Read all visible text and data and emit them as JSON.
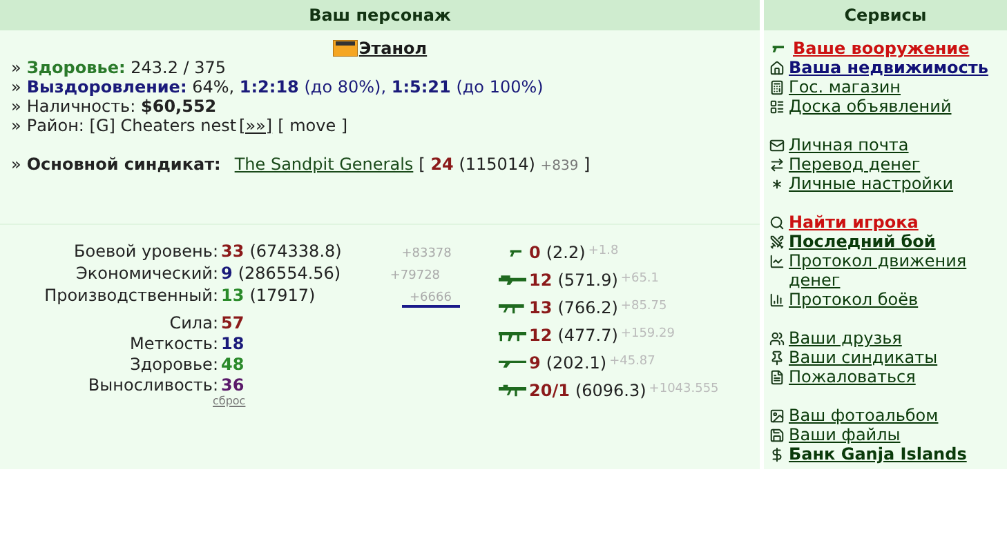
{
  "character": {
    "title": "Ваш персонаж",
    "name": "Этанол",
    "health": {
      "bullet": "»",
      "label": "Здоровье:",
      "value": "243.2 / 375"
    },
    "recovery": {
      "bullet": "»",
      "label": "Выздоровление:",
      "percent": "64%,",
      "t1": "1:2:18",
      "t1_note": "(до 80%),",
      "t2": "1:5:21",
      "t2_note": "(до 100%)"
    },
    "cash": {
      "bullet": "»",
      "label": "Наличность:",
      "value": "$60,552"
    },
    "district": {
      "bullet": "»",
      "label": "Район:",
      "value": "[G] Cheaters nest",
      "link": "[»»]",
      "move": "[ move ]"
    },
    "syndicate": {
      "bullet": "»",
      "label": "Основной синдикат:",
      "name": "The Sandpit Generals",
      "open": "[",
      "level": "24",
      "points": "(115014)",
      "delta": "+839",
      "close": "]"
    }
  },
  "levels": [
    {
      "label": "Боевой уровень:",
      "value": "33",
      "detail": "(674338.8)",
      "delta": "+83378",
      "color": "#8b1a1a",
      "underlined": false
    },
    {
      "label": "Экономический:",
      "value": "9",
      "detail": "(286554.56)",
      "delta": "+79728",
      "color": "#1a1a7a",
      "underlined": false
    },
    {
      "label": "Производственный:",
      "value": "13",
      "detail": "(17917)",
      "delta": "+6666",
      "color": "#2a8a2a",
      "underlined": true
    }
  ],
  "attributes": [
    {
      "label": "Сила:",
      "value": "57",
      "color": "#8b1a1a"
    },
    {
      "label": "Меткость:",
      "value": "18",
      "color": "#1a1a7a"
    },
    {
      "label": "Здоровье:",
      "value": "48",
      "color": "#2a8a2a"
    },
    {
      "label": "Выносливость:",
      "value": "36",
      "color": "#5a1a6a"
    }
  ],
  "reset": "сброс",
  "weapons": [
    {
      "kind": "pistol",
      "level": "0",
      "detail": "(2.2)",
      "delta": "+1.8"
    },
    {
      "kind": "shotgun",
      "level": "12",
      "detail": "(571.9)",
      "delta": "+65.1"
    },
    {
      "kind": "smg",
      "level": "13",
      "detail": "(766.2)",
      "delta": "+85.75"
    },
    {
      "kind": "machinegun",
      "level": "12",
      "detail": "(477.7)",
      "delta": "+159.29"
    },
    {
      "kind": "rifle",
      "level": "9",
      "detail": "(202.1)",
      "delta": "+45.87"
    },
    {
      "kind": "launcher",
      "level": "20/1",
      "detail": "(6096.3)",
      "delta": "+1043.555"
    }
  ],
  "services": {
    "title": "Сервисы",
    "groups": [
      [
        {
          "label": "Ваше вооружение",
          "kind": "pistol",
          "color": "#cc1111",
          "bold": true
        },
        {
          "label": "Ваша недвижимость",
          "kind": "house",
          "color": "#111177",
          "bold": true
        },
        {
          "label": "Гос. магазин",
          "kind": "calculator",
          "color": "#0a3a0a",
          "bold": false
        },
        {
          "label": "Доска объявлений",
          "kind": "board",
          "color": "#0a3a0a",
          "bold": false
        }
      ],
      [
        {
          "label": "Личная почта",
          "kind": "mail",
          "color": "#0a3a0a",
          "bold": false
        },
        {
          "label": "Перевод денег",
          "kind": "transfer",
          "color": "#0a3a0a",
          "bold": false
        },
        {
          "label": "Личные настройки",
          "kind": "gear",
          "color": "#0a3a0a",
          "bold": false
        }
      ],
      [
        {
          "label": "Найти игрока",
          "kind": "search",
          "color": "#cc1111",
          "bold": true
        },
        {
          "label": "Последний бой",
          "kind": "fight",
          "color": "#0a3a0a",
          "bold": true
        },
        {
          "label": "Протокол движения денег",
          "kind": "chart",
          "color": "#0a3a0a",
          "bold": false
        },
        {
          "label": "Протокол боёв",
          "kind": "bars",
          "color": "#0a3a0a",
          "bold": false
        }
      ],
      [
        {
          "label": "Ваши друзья",
          "kind": "friends",
          "color": "#0a3a0a",
          "bold": false
        },
        {
          "label": "Ваши синдикаты",
          "kind": "pin",
          "color": "#0a3a0a",
          "bold": false
        },
        {
          "label": "Пожаловаться",
          "kind": "note",
          "color": "#0a3a0a",
          "bold": false
        }
      ],
      [
        {
          "label": "Ваш фотоальбом",
          "kind": "photo",
          "color": "#0a3a0a",
          "bold": false
        },
        {
          "label": "Ваши файлы",
          "kind": "save",
          "color": "#0a3a0a",
          "bold": false
        },
        {
          "label": "Банк Ganja Islands",
          "kind": "dollar",
          "color": "#0a3a0a",
          "bold": true
        }
      ]
    ]
  }
}
